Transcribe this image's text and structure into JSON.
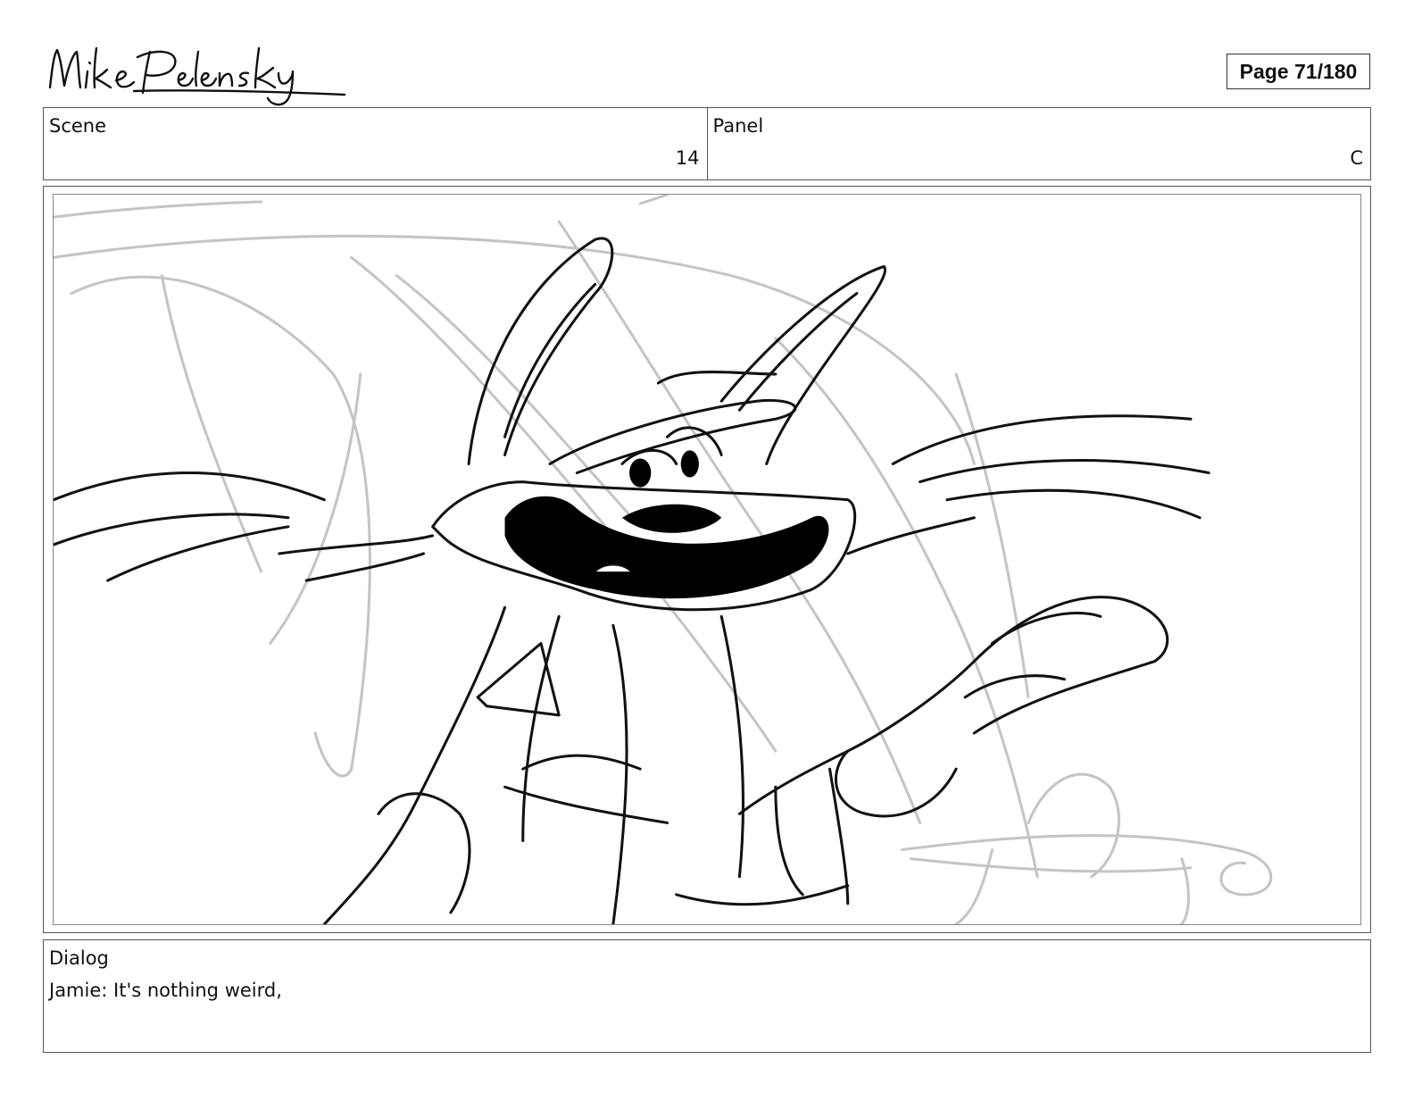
{
  "header": {
    "artist_signature": "Mike Pelensky",
    "page_label": "Page",
    "page_number": "71/180"
  },
  "scene": {
    "label": "Scene",
    "value": "14"
  },
  "panel": {
    "label": "Panel",
    "value": "C"
  },
  "artwork": {
    "subject": "cat-character-sketch"
  },
  "dialog": {
    "label": "Dialog",
    "text": "Jamie: It's nothing weird,"
  }
}
